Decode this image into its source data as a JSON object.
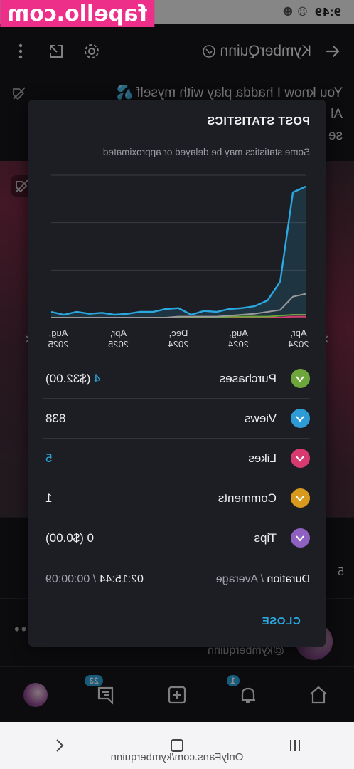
{
  "watermark": "fapello.com",
  "status_bar": {
    "time": "9:49"
  },
  "header": {
    "title": "KymberQuinn",
    "back_icon": "arrow-left-icon",
    "share_icon": "share-icon",
    "settings_icon": "gear-icon",
    "more_icon": "more-vertical-icon"
  },
  "caption": {
    "line1": "You know I hadda play with myself 💦",
    "line2": "Al",
    "line3": "se"
  },
  "below_media": {
    "likes_fragment": "5"
  },
  "post_author": {
    "handle": "@kymberquinn"
  },
  "bottom_nav": {
    "items": [
      {
        "name": "home",
        "icon": "home-icon"
      },
      {
        "name": "notifications",
        "icon": "bell-icon",
        "badge": "1"
      },
      {
        "name": "new-post",
        "icon": "plus-square-icon"
      },
      {
        "name": "messages",
        "icon": "message-icon",
        "badge": "23"
      },
      {
        "name": "profile",
        "icon": "avatar"
      }
    ]
  },
  "system_nav": {
    "url": "OnlyFans.com/kymberquinn"
  },
  "modal": {
    "title": "POST STATISTICS",
    "note": "Some statistics may be delayed or approximated",
    "stats": [
      {
        "label": "Purchases",
        "count": "4",
        "value": "($32.00)",
        "color": "#6da63a"
      },
      {
        "label": "Views",
        "value": "838",
        "color": "#2e9bd6"
      },
      {
        "label": "Likes",
        "value": "5",
        "color": "#d83a6f"
      },
      {
        "label": "Comments",
        "value": "1",
        "color": "#d79a1c"
      },
      {
        "label": "Tips",
        "value": "0 ($0.00)",
        "color": "#8e60c0"
      }
    ],
    "duration": {
      "label": "Duration",
      "sep": " / ",
      "label2": "Average",
      "value": "02:15:44",
      "sep2": " / ",
      "avg": "00:00:09"
    },
    "close_label": "CLOSE"
  },
  "chart_data": {
    "type": "line",
    "x_tick_labels": [
      [
        "Apr,",
        "2024"
      ],
      [
        "Aug,",
        "2024"
      ],
      [
        "Dec,",
        "2024"
      ],
      [
        "Apr,",
        "2025"
      ],
      [
        "Aug,",
        "2025"
      ]
    ],
    "series": [
      {
        "name": "Views",
        "color": "#2ba8e0",
        "values": [
          138,
          132,
          38,
          18,
          12,
          10,
          9,
          6,
          7,
          3,
          10,
          9,
          6,
          6,
          4,
          3,
          5,
          4,
          6,
          3,
          6
        ]
      },
      {
        "name": "Purchases",
        "color": "#9a9a9a",
        "values": [
          25,
          22,
          8,
          6,
          4,
          3,
          2,
          1,
          1,
          1,
          1,
          0,
          0,
          0,
          0,
          0,
          0,
          0,
          0,
          0,
          0
        ]
      },
      {
        "name": "Likes",
        "color": "#6da63a",
        "values": [
          3,
          3,
          2,
          1,
          1,
          1,
          1,
          0,
          0,
          0,
          0,
          0,
          0,
          0,
          0,
          0,
          0,
          0,
          0,
          0,
          0
        ]
      },
      {
        "name": "Tips",
        "color": "#d83a6f",
        "values": [
          1,
          1,
          0,
          0,
          0,
          0,
          0,
          0,
          0,
          0,
          0,
          0,
          0,
          0,
          0,
          0,
          0,
          0,
          0,
          0,
          0
        ]
      }
    ],
    "ylim": [
      0,
      150
    ],
    "grid": true
  }
}
